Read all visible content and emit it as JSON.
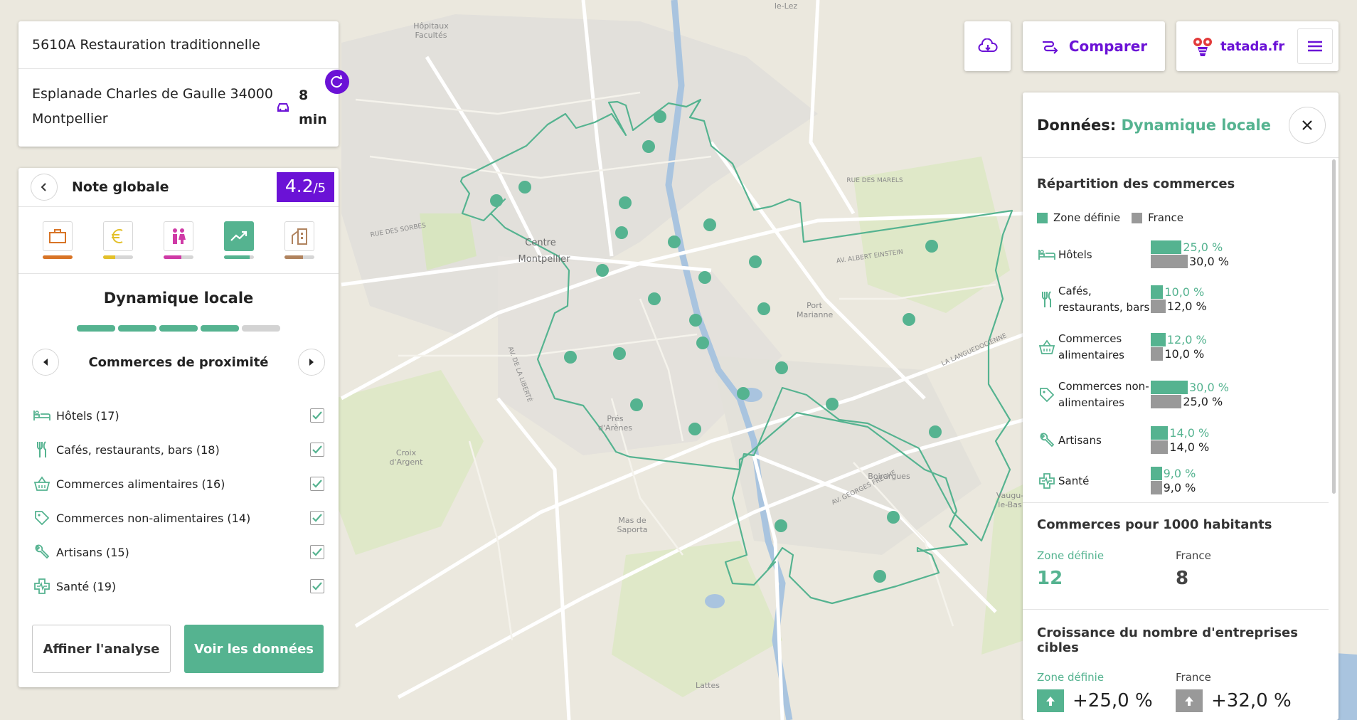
{
  "map": {
    "labels": [
      {
        "text": "Hôpitaux Facultés"
      },
      {
        "text": "Centre"
      },
      {
        "text": "Montpellier"
      },
      {
        "text": "Port Marianne"
      },
      {
        "text": "Prés d'Arènes"
      },
      {
        "text": "Croix d'Argent"
      },
      {
        "text": "Mas de Saporta"
      },
      {
        "text": "Boirargues"
      },
      {
        "text": "Lattes"
      },
      {
        "text": "AV. ALBERT EINSTEIN"
      },
      {
        "text": "LA LANGUEDOCIENNE"
      },
      {
        "text": "AV. GEORGES FRÊCHE"
      },
      {
        "text": "AV. DE LA LIBERTÉ"
      },
      {
        "text": "RUE DES SORBES"
      },
      {
        "text": "RUE DES MARELS"
      },
      {
        "text": "Vaugu- le-Bas"
      },
      {
        "text": "le-Lez"
      }
    ]
  },
  "search": {
    "activity": "5610A Restauration traditionnelle",
    "address": "Esplanade Charles de Gaulle 34000 Montpellier",
    "travel_time": "8 min",
    "travel_icon": "car-icon"
  },
  "score": {
    "title": "Note globale",
    "value": "4.2",
    "max": "/5",
    "categories": [
      {
        "name": "business",
        "icon": "briefcase-icon",
        "color": "#d87426",
        "level": 1.0
      },
      {
        "name": "money",
        "icon": "euro-icon",
        "color": "#e3c02a",
        "level": 0.4
      },
      {
        "name": "population",
        "icon": "people-icon",
        "color": "#cf3aa6",
        "level": 0.6
      },
      {
        "name": "dynamics",
        "icon": "trend-icon",
        "color": "#55b390",
        "level": 0.85
      },
      {
        "name": "real-estate",
        "icon": "building-icon",
        "color": "#b0835e",
        "level": 0.6
      }
    ],
    "section_title": "Dynamique locale",
    "progress_level": 4,
    "progress_total": 5,
    "subcategory": "Commerces de proximité",
    "items": [
      {
        "label": "Hôtels (17)",
        "icon": "bed-icon",
        "checked": true
      },
      {
        "label": "Cafés, restaurants, bars (18)",
        "icon": "cutlery-icon",
        "checked": true
      },
      {
        "label": "Commerces alimentaires (16)",
        "icon": "basket-icon",
        "checked": true
      },
      {
        "label": "Commerces non-alimentaires (14)",
        "icon": "tag-icon",
        "checked": true
      },
      {
        "label": "Artisans (15)",
        "icon": "wrench-icon",
        "checked": true
      },
      {
        "label": "Santé (19)",
        "icon": "health-icon",
        "checked": true
      }
    ],
    "refine_label": "Affiner l'analyse",
    "data_label": "Voir les données"
  },
  "toolbar": {
    "compare_label": "Comparer",
    "brand": "tatada.fr"
  },
  "data_panel": {
    "title_prefix": "Données: ",
    "title_accent": "Dynamique locale",
    "repartition_title": "Répartition des commerces",
    "legend_zone": "Zone définie",
    "legend_france": "France",
    "colors": {
      "zone": "#55b390",
      "france": "#999999"
    },
    "rows": [
      {
        "label": "Hôtels",
        "icon": "bed-icon",
        "zone": 25.0,
        "france": 30.0,
        "zone_text": "25,0 %",
        "france_text": "30,0 %"
      },
      {
        "label": "Cafés, restaurants, bars",
        "icon": "cutlery-icon",
        "zone": 10.0,
        "france": 12.0,
        "zone_text": "10,0 %",
        "france_text": "12,0 %"
      },
      {
        "label": "Commerces alimentaires",
        "icon": "basket-icon",
        "zone": 12.0,
        "france": 10.0,
        "zone_text": "12,0 %",
        "france_text": "10,0 %"
      },
      {
        "label": "Commerces non-alimentaires",
        "icon": "tag-icon",
        "zone": 30.0,
        "france": 25.0,
        "zone_text": "30,0 %",
        "france_text": "25,0 %"
      },
      {
        "label": "Artisans",
        "icon": "wrench-icon",
        "zone": 14.0,
        "france": 14.0,
        "zone_text": "14,0 %",
        "france_text": "14,0 %"
      },
      {
        "label": "Santé",
        "icon": "health-icon",
        "zone": 9.0,
        "france": 9.0,
        "zone_text": "9,0 %",
        "france_text": "9,0 %"
      }
    ],
    "per1000_title": "Commerces pour 1000 habitants",
    "per1000_zone_label": "Zone définie",
    "per1000_zone_value": "12",
    "per1000_france_label": "France",
    "per1000_france_value": "8",
    "growth_title": "Croissance du nombre d'entreprises cibles",
    "growth_zone_label": "Zone définie",
    "growth_zone_value": "+25,0 %",
    "growth_france_label": "France",
    "growth_france_value": "+32,0 %"
  }
}
